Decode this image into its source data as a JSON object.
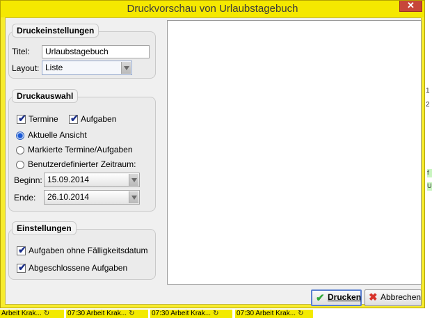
{
  "window": {
    "title": "Druckvorschau von Urlaubstagebuch",
    "close": "✕"
  },
  "print_settings": {
    "heading": "Druckeinstellungen",
    "title_label": "Titel:",
    "title_value": "Urlaubstagebuch",
    "layout_label": "Layout:",
    "layout_value": "Liste"
  },
  "print_selection": {
    "heading": "Druckauswahl",
    "appointments_label": "Termine",
    "tasks_label": "Aufgaben",
    "radio_current": "Aktuelle Ansicht",
    "radio_marked": "Markierte Termine/Aufgaben",
    "radio_custom": "Benutzerdefinierter Zeitraum:",
    "begin_label": "Beginn:",
    "begin_value": "15.09.2014",
    "end_label": "Ende:",
    "end_value": "26.10.2014"
  },
  "settings": {
    "heading": "Einstellungen",
    "no_due_label": "Aufgaben ohne Fälligkeitsdatum",
    "completed_label": "Abgeschlossene Aufgaben"
  },
  "buttons": {
    "print": "Drucken",
    "print_icon": "✔",
    "cancel": "Abbrechen",
    "cancel_icon": "✖"
  },
  "background": {
    "strip_items": [
      {
        "time": "",
        "text": "Arbeit Krak..."
      },
      {
        "time": "07:30",
        "text": "Arbeit Krak..."
      },
      {
        "time": "07:30",
        "text": "Arbeit Krak..."
      },
      {
        "time": "07:30",
        "text": "Arbeit Krak..."
      }
    ],
    "sync_glyph": "↻",
    "side_marks": [
      "1",
      "2",
      "f",
      "U"
    ]
  },
  "colors": {
    "accent": "#1c5ad6",
    "titlebar": "#f5e800",
    "close": "#c7463a"
  }
}
